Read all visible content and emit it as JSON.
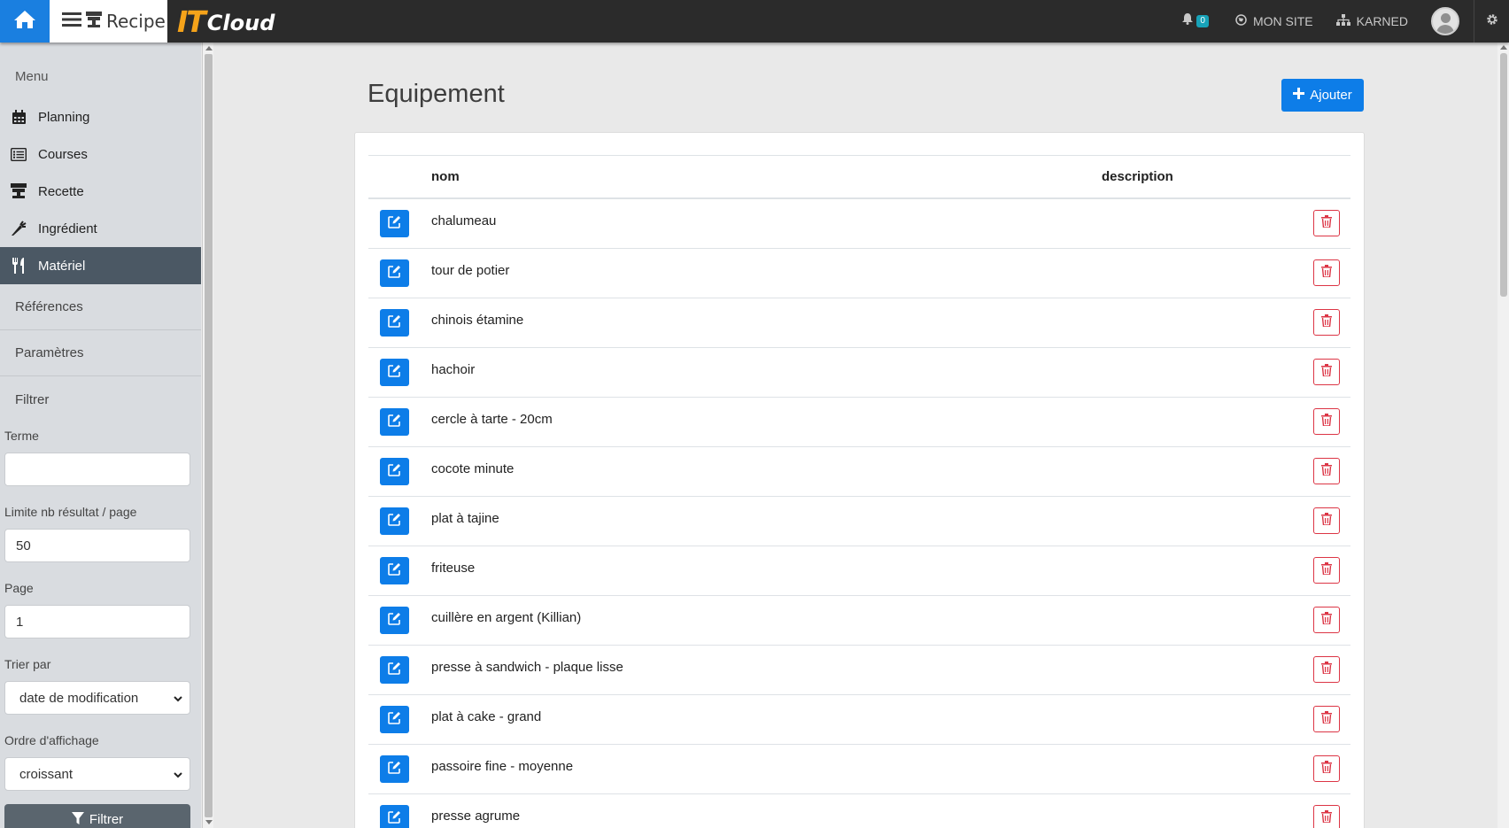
{
  "app": {
    "name": "Recipe",
    "logo_it": "IT",
    "logo_cloud": "Cloud",
    "accent": "#1a7fe0",
    "logo_color": "#f5a31a"
  },
  "topbar": {
    "notifications_count": "0",
    "site_label": "MON SITE",
    "org_label": "KARNED"
  },
  "sidebar": {
    "menu_title": "Menu",
    "items": [
      {
        "label": "Planning",
        "icon": "calendar-icon",
        "active": false
      },
      {
        "label": "Courses",
        "icon": "list-icon",
        "active": false
      },
      {
        "label": "Recette",
        "icon": "recipe-icon",
        "active": false
      },
      {
        "label": "Ingrédient",
        "icon": "carrot-icon",
        "active": false
      },
      {
        "label": "Matériel",
        "icon": "utensils-icon",
        "active": true
      }
    ],
    "references_label": "Références",
    "parametres_label": "Paramètres",
    "filter": {
      "title": "Filtrer",
      "term_label": "Terme",
      "term_value": "",
      "limit_label": "Limite nb résultat / page",
      "limit_value": "50",
      "page_label": "Page",
      "page_value": "1",
      "sort_label": "Trier par",
      "sort_value": "date de modification",
      "order_label": "Ordre d'affichage",
      "order_value": "croissant",
      "button_label": "Filtrer"
    }
  },
  "main": {
    "title": "Equipement",
    "add_label": "Ajouter",
    "columns": [
      "nom",
      "description"
    ],
    "rows": [
      {
        "name": "chalumeau",
        "description": ""
      },
      {
        "name": "tour de potier",
        "description": ""
      },
      {
        "name": "chinois étamine",
        "description": ""
      },
      {
        "name": "hachoir",
        "description": ""
      },
      {
        "name": "cercle à tarte - 20cm",
        "description": ""
      },
      {
        "name": "cocote minute",
        "description": ""
      },
      {
        "name": "plat à tajine",
        "description": ""
      },
      {
        "name": "friteuse",
        "description": ""
      },
      {
        "name": "cuillère en argent (Killian)",
        "description": ""
      },
      {
        "name": "presse à sandwich - plaque lisse",
        "description": ""
      },
      {
        "name": "plat à cake - grand",
        "description": ""
      },
      {
        "name": "passoire fine - moyenne",
        "description": ""
      },
      {
        "name": "presse agrume",
        "description": ""
      }
    ]
  }
}
